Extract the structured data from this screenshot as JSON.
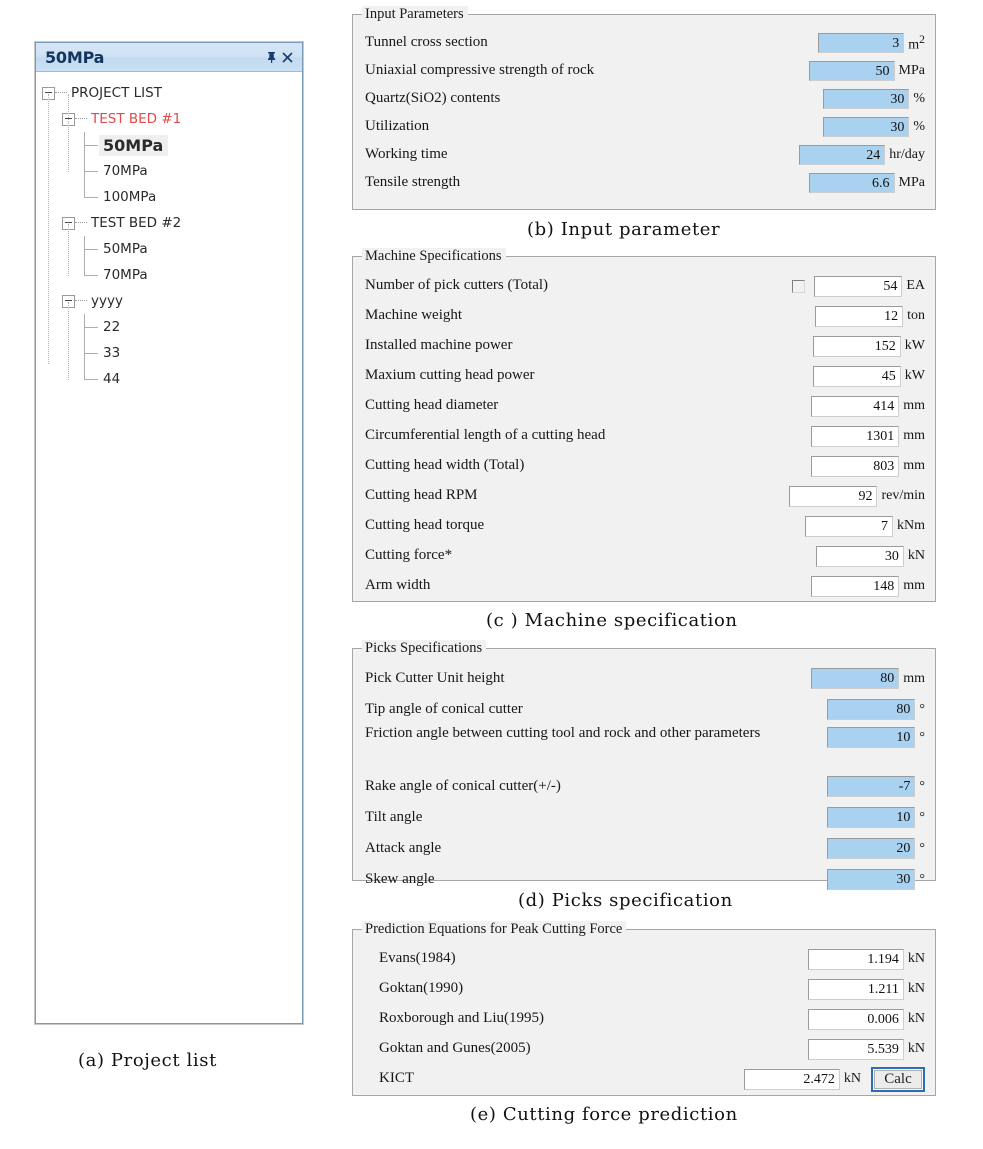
{
  "project_panel": {
    "title": "50MPa",
    "pin_icon": "pin-icon",
    "close_icon": "close-icon",
    "tree": [
      {
        "label": "PROJECT LIST",
        "level": 0,
        "type": "root",
        "style": "normal"
      },
      {
        "label": "TEST BED #1",
        "level": 1,
        "type": "branch",
        "style": "red"
      },
      {
        "label": "50MPa",
        "level": 2,
        "type": "leaf",
        "style": "selected"
      },
      {
        "label": "70MPa",
        "level": 2,
        "type": "leaf",
        "style": "normal"
      },
      {
        "label": "100MPa",
        "level": 2,
        "type": "leaf-last",
        "style": "normal"
      },
      {
        "label": "TEST BED #2",
        "level": 1,
        "type": "branch",
        "style": "normal"
      },
      {
        "label": "50MPa",
        "level": 2,
        "type": "leaf",
        "style": "normal"
      },
      {
        "label": "70MPa",
        "level": 2,
        "type": "leaf-last",
        "style": "normal"
      },
      {
        "label": "yyyy",
        "level": 1,
        "type": "branch",
        "style": "normal"
      },
      {
        "label": "22",
        "level": 2,
        "type": "leaf",
        "style": "normal"
      },
      {
        "label": "33",
        "level": 2,
        "type": "leaf",
        "style": "normal"
      },
      {
        "label": "44",
        "level": 2,
        "type": "leaf-last",
        "style": "normal"
      }
    ]
  },
  "captions": {
    "a": "(a) Project list",
    "b": "(b) Input parameter",
    "c": "(c ) Machine specification",
    "d": "(d) Picks specification",
    "e": "(e) Cutting force prediction"
  },
  "input_parameters": {
    "title": "Input Parameters",
    "rows": [
      {
        "label": "Tunnel cross section",
        "value": "3",
        "unit": "m",
        "unit_sup": "2",
        "field_style": "blue"
      },
      {
        "label": "Uniaxial compressive strength of rock",
        "value": "50",
        "unit": "MPa",
        "field_style": "blue"
      },
      {
        "label": "Quartz(SiO2) contents",
        "value": "30",
        "unit": "%",
        "field_style": "blue"
      },
      {
        "label": "Utilization",
        "value": "30",
        "unit": "%",
        "field_style": "blue"
      },
      {
        "label": "Working time",
        "value": "24",
        "unit": "hr/day",
        "field_style": "blue"
      },
      {
        "label": "Tensile strength",
        "value": "6.6",
        "unit": "MPa",
        "field_style": "blue"
      }
    ]
  },
  "machine_specifications": {
    "title": "Machine Specifications",
    "rows": [
      {
        "label": "Number of pick cutters (Total)",
        "value": "54",
        "unit": "EA",
        "checkbox": true,
        "checked": false
      },
      {
        "label": "Machine weight",
        "value": "12",
        "unit": "ton"
      },
      {
        "label": "Installed machine power",
        "value": "152",
        "unit": "kW"
      },
      {
        "label": "Maxium cutting head power",
        "value": "45",
        "unit": "kW"
      },
      {
        "label": "Cutting head diameter",
        "value": "414",
        "unit": "mm"
      },
      {
        "label": "Circumferential length of a cutting head",
        "value": "1301",
        "unit": "mm"
      },
      {
        "label": "Cutting head width (Total)",
        "value": "803",
        "unit": "mm"
      },
      {
        "label": "Cutting head RPM",
        "value": "92",
        "unit": "rev/min"
      },
      {
        "label": "Cutting head torque",
        "value": "7",
        "unit": "kNm"
      },
      {
        "label": "Cutting force*",
        "value": "30",
        "unit": "kN"
      },
      {
        "label": "Arm width",
        "value": "148",
        "unit": "mm"
      }
    ]
  },
  "picks_specifications": {
    "title": "Picks Specifications",
    "rows": [
      {
        "label": "Pick Cutter Unit height",
        "value": "80",
        "unit": "mm",
        "field_style": "blue"
      },
      {
        "label": "Tip angle of conical cutter",
        "value": "80",
        "unit": "°",
        "field_style": "blue"
      },
      {
        "label": "Friction angle between cutting tool and rock and other parameters",
        "value": "10",
        "unit": "°",
        "field_style": "blue",
        "tall": true
      },
      {
        "label": "Rake angle of conical cutter(+/-)",
        "value": "-7",
        "unit": "°",
        "field_style": "blue"
      },
      {
        "label": "Tilt angle",
        "value": "10",
        "unit": "°",
        "field_style": "blue"
      },
      {
        "label": "Attack angle",
        "value": "20",
        "unit": "°",
        "field_style": "blue"
      },
      {
        "label": "Skew angle",
        "value": "30",
        "unit": "°",
        "field_style": "blue"
      }
    ]
  },
  "prediction": {
    "title": "Prediction Equations for Peak Cutting Force",
    "calc_label": "Calc",
    "rows": [
      {
        "label": "Evans(1984)",
        "value": "1.194",
        "unit": "kN"
      },
      {
        "label": "Goktan(1990)",
        "value": "1.211",
        "unit": "kN"
      },
      {
        "label": "Roxborough and Liu(1995)",
        "value": "0.006",
        "unit": "kN"
      },
      {
        "label": "Goktan and Gunes(2005)",
        "value": "5.539",
        "unit": "kN"
      },
      {
        "label": "KICT",
        "value": "2.472",
        "unit": "kN",
        "has_calc": true
      }
    ]
  },
  "colors": {
    "field_blue": "#a9d2f0",
    "title_bar": "#cfe1f4",
    "tree_red": "#e04a4a",
    "accent": "#2a6fb5"
  }
}
